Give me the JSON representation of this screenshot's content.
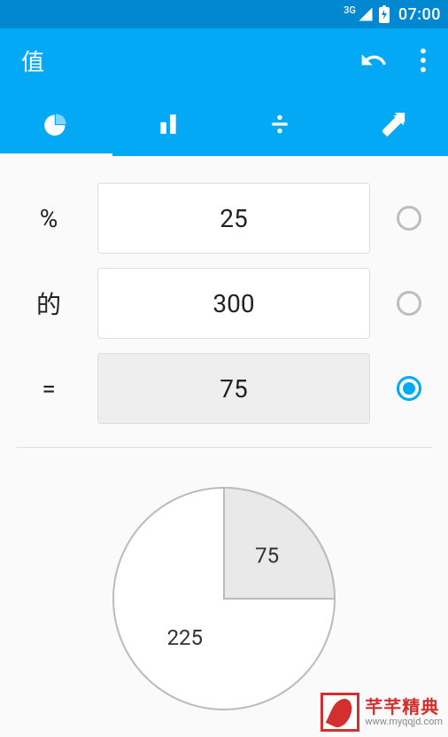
{
  "status": {
    "network": "3G",
    "time": "07:00"
  },
  "header": {
    "title": "值"
  },
  "tabs": {
    "active_index": 0
  },
  "rows": [
    {
      "label": "%",
      "value": "25",
      "selected": false,
      "highlight": false
    },
    {
      "label": "的",
      "value": "300",
      "selected": false,
      "highlight": false
    },
    {
      "label": "=",
      "value": "75",
      "selected": true,
      "highlight": true
    }
  ],
  "chart_data": {
    "type": "pie",
    "title": "",
    "series": [
      {
        "name": "result",
        "value": 75,
        "label": "75"
      },
      {
        "name": "remainder",
        "value": 225,
        "label": "225"
      }
    ],
    "total": 300
  },
  "watermark": {
    "name": "芊芊精典",
    "url": "www.myqqjd.com"
  }
}
